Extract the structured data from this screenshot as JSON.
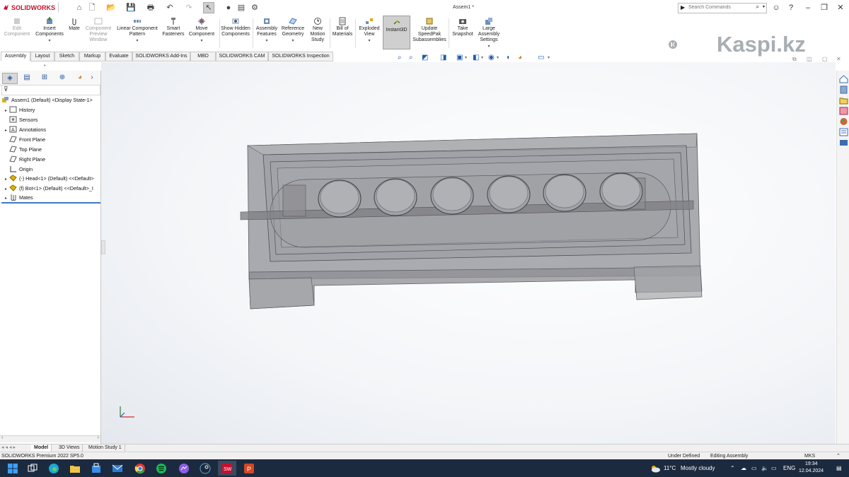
{
  "app": {
    "logo_text": "SOLIDWORKS",
    "document_title": "Assem1 *",
    "brand_color": "#c8102e"
  },
  "search": {
    "placeholder": "Search Commands"
  },
  "ribbon": {
    "items": [
      {
        "label": "Edit Component",
        "disabled": true
      },
      {
        "label": "Insert Components",
        "disabled": false
      },
      {
        "label": "Mate",
        "disabled": false
      },
      {
        "label": "Component Preview Window",
        "disabled": true
      },
      {
        "label": "Linear Component Pattern",
        "disabled": false
      },
      {
        "label": "Smart Fasteners",
        "disabled": false
      },
      {
        "label": "Move Component",
        "disabled": false
      },
      {
        "label": "Show Hidden Components",
        "disabled": false
      },
      {
        "label": "Assembly Features",
        "disabled": false
      },
      {
        "label": "Reference Geometry",
        "disabled": false
      },
      {
        "label": "New Motion Study",
        "disabled": false
      },
      {
        "label": "Bill of Materials",
        "disabled": false
      },
      {
        "label": "Exploded View",
        "disabled": false
      },
      {
        "label": "Instant3D",
        "disabled": false,
        "active": true
      },
      {
        "label": "Update SpeedPak Subassemblies",
        "disabled": false
      },
      {
        "label": "Take Snapshot",
        "disabled": false
      },
      {
        "label": "Large Assembly Settings",
        "disabled": false
      }
    ]
  },
  "tabs": [
    "Assembly",
    "Layout",
    "Sketch",
    "Markup",
    "Evaluate",
    "SOLIDWORKS Add-Ins",
    "MBD",
    "SOLIDWORKS CAM",
    "SOLIDWORKS Inspection"
  ],
  "tree": {
    "root": "Assem1 (Default) <Display State-1>",
    "items": [
      {
        "label": "History",
        "expandable": true
      },
      {
        "label": "Sensors",
        "expandable": false
      },
      {
        "label": "Annotations",
        "expandable": true
      },
      {
        "label": "Front Plane",
        "expandable": false
      },
      {
        "label": "Top Plane",
        "expandable": false
      },
      {
        "label": "Right Plane",
        "expandable": false
      },
      {
        "label": "Origin",
        "expandable": false
      },
      {
        "label": "(-) Head<1> (Default) <<Default>",
        "expandable": true
      },
      {
        "label": "(f) Bot<1> (Default) <<Default>_I",
        "expandable": true
      },
      {
        "label": "Mates",
        "expandable": true
      }
    ]
  },
  "bottom_tabs": [
    "Model",
    "3D Views",
    "Motion Study 1"
  ],
  "status": {
    "product": "SOLIDWORKS Premium 2022 SP5.0",
    "definition": "Under Defined",
    "mode": "Editing Assembly",
    "units": "MKS"
  },
  "taskbar": {
    "weather_temp": "11°C",
    "weather_text": "Mostly cloudy",
    "language": "ENG",
    "time": "19:34",
    "date": "12.04.2024"
  },
  "watermark": {
    "text": "Kaspi.kz"
  }
}
